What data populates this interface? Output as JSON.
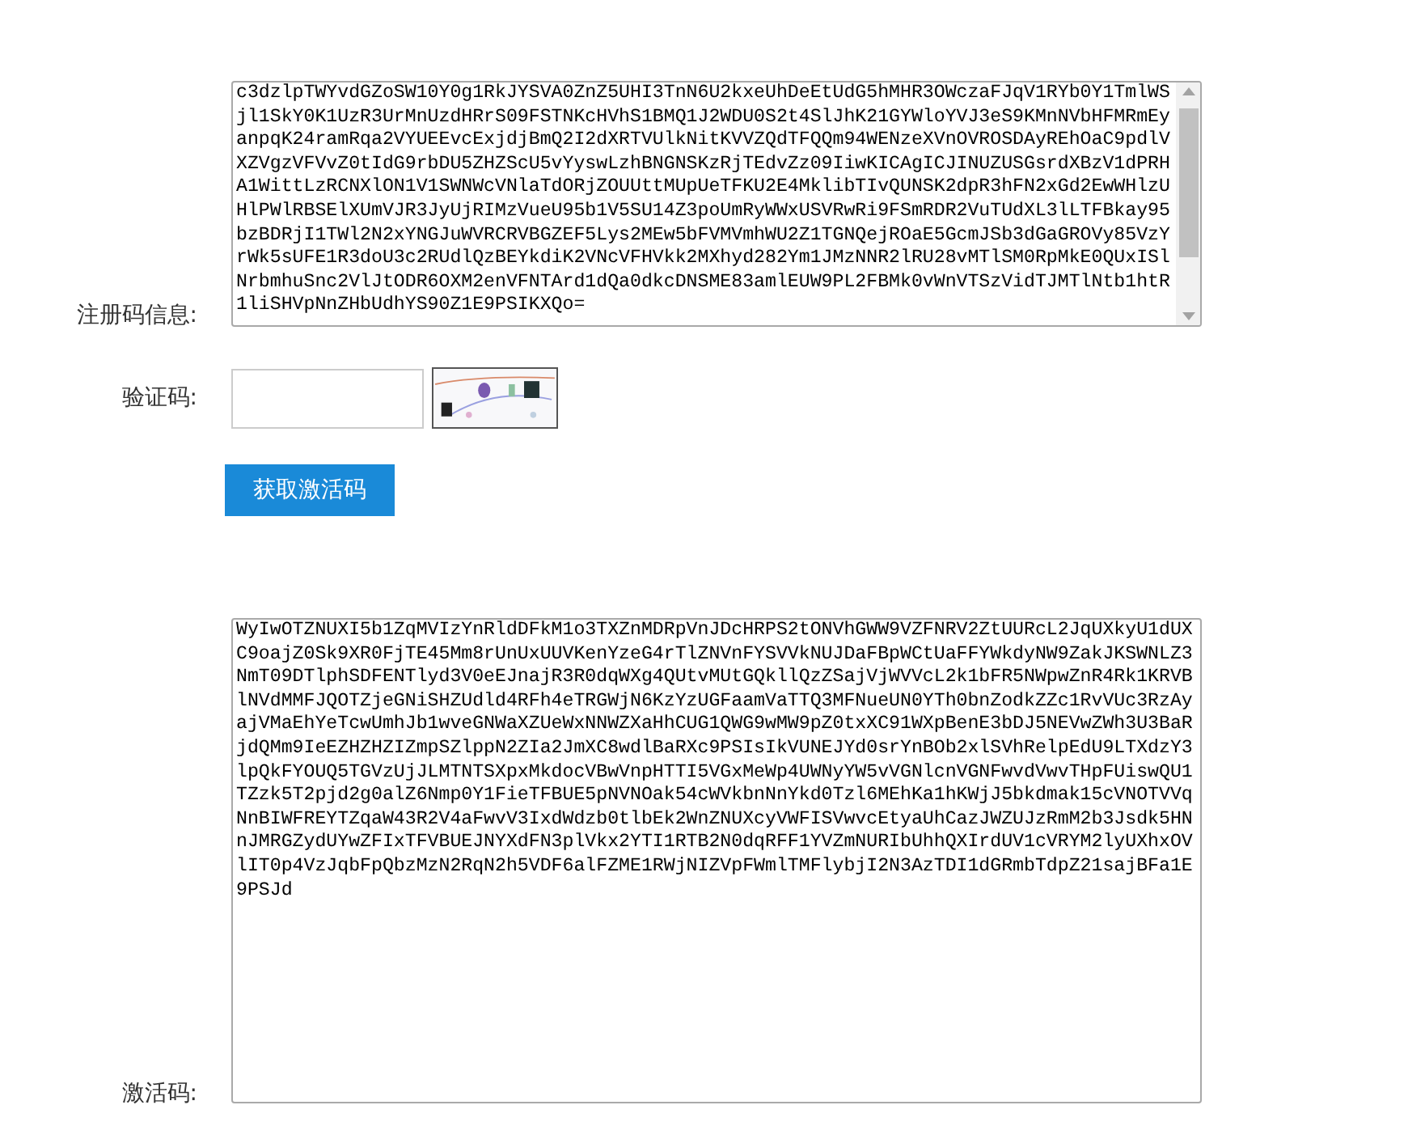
{
  "registration_code": {
    "label": "注册码信息:",
    "lines": [
      "c3dzlpTWYvdGZoSW10Y0g1RkJYSVA0ZnZ5UHI3TnN6U2kxeUhDeEtUdG5hMHR3OWczaFJqV1RYb0Y1TmlWS",
      "jl1SkY0K1UzR3UrMnUzdHRrS09FSTNKcHVhS1BMQ1J2WDU0S2t4SlJhK21GYWloYVJ3eS9KMnNVbHFMRmEy",
      "anpqK24ramRqa2VYUEEvcExjdjBmQ2I2dXRTVUlkNitKVVZQdTFQQm94WENzeXVnOVROSDAyREhOaC9pdlV",
      "XZVgzVFVvZ0tIdG9rbDU5ZHZScU5vYyswLzhBNGNSKzRjTEdvZz09IiwKICAgICJINUZUSGsrdXBzV1dPRH",
      "A1WittLzRCNXlON1V1SWNWcVNlaTdORjZOUUttMUpUeTFKU2E4MklibTIvQUNSK2dpR3hFN2xGd2EwWHlzU",
      "HlPWlRBSElXUmVJR3JyUjRIMzVueU95b1V5SU14Z3poUmRyWWxUSVRwRi9FSmRDR2VuTUdXL3lLTFBkay95",
      "bzBDRjI1TWl2N2xYNGJuWVRCRVBGZEF5Lys2MEw5bFVMVmhWU2Z1TGNQejROaE5GcmJSb3dGaGROVy85VzY",
      "rWk5sUFE1R3doU3c2RUdlQzBEYkdiK2VNcVFHVkk2MXhyd282Ym1JMzNNR2lRU28vMTlSM0RpMkE0QUxISl",
      "NrbmhuSnc2VlJtODR6OXM2enVFNTArd1dQa0dkcDNSME83amlEUW9PL2FBMk0vWnVTSzVidTJMTlNtb1htR",
      "1liSHVpNnZHbUdhYS90Z1E9PSIKXQo="
    ]
  },
  "captcha": {
    "label": "验证码:"
  },
  "get_code_button": {
    "label": "获取激活码"
  },
  "activation_code": {
    "label": "激活码:",
    "lines": [
      "WyIwOTZNUXI5b1ZqMVIzYnRldDFkM1o3TXZnMDRpVnJDcHRPS2tONVhGWW9VZFNRV2ZtUURcL2JqUXkyU1dUX",
      "C9oajZ0Sk9XR0FjTE45Mm8rUnUxUUVKenYzeG4rTlZNVnFYSVVkNUJDaFBpWCtUaFFYWkdyNW9ZakJKSWNLZ3",
      "NmT09DTlphSDFENTlyd3V0eEJnajR3R0dqWXg4QUtvMUtGQkllQzZSajVjWVVcL2k1bFR5NWpwZnR4Rk1KRVB",
      "lNVdMMFJQOTZjeGNiSHZUdld4RFh4eTRGWjN6KzYzUGFaamVaTTQ3MFNueUN0YTh0bnZodkZZc1RvVUc3RzAy",
      "ajVMaEhYeTcwUmhJb1wveGNWaXZUeWxNNWZXaHhCUG1QWG9wMW9pZ0txXC91WXpBenE3bDJ5NEVwZWh3U3BaR",
      "jdQMm9IeEZHZHZIZmpSZlppN2ZIa2JmXC8wdlBaRXc9PSIsIkVUNEJYd0srYnBOb2xlSVhRelpEdU9LTXdzY3",
      "lpQkFYOUQ5TGVzUjJLMTNTSXpxMkdocVBwVnpHTTI5VGxMeWp4UWNyYW5vVGNlcnVGNFwvdVwvTHpFUiswQU1",
      "TZzk5T2pjd2g0alZ6Nmp0Y1FieTFBUE5pNVNOak54cWVkbnNnYkd0Tzl6MEhKa1hKWjJ5bkdmak15cVNOTVVq",
      "NnBIWFREYTZqaW43R2V4aFwvV3IxdWdzb0tlbEk2WnZNUXcyVWFISVwvcEtyaUhCazJWZUJzRmM2b3Jsdk5HN",
      "nJMRGZydUYwZFIxTFVBUEJNYXdFN3plVkx2YTI1RTB2N0dqRFF1YVZmNURIbUhhQXIrdUV1cVRYM2lyUXhxOV",
      "lIT0p4VzJqbFpQbzMzN2RqN2h5VDF6alFZME1RWjNIZVpFWmlTMFlybjI2N3AzTDI1dGRmbTdpZ21sajBFa1E",
      "9PSJd"
    ]
  }
}
